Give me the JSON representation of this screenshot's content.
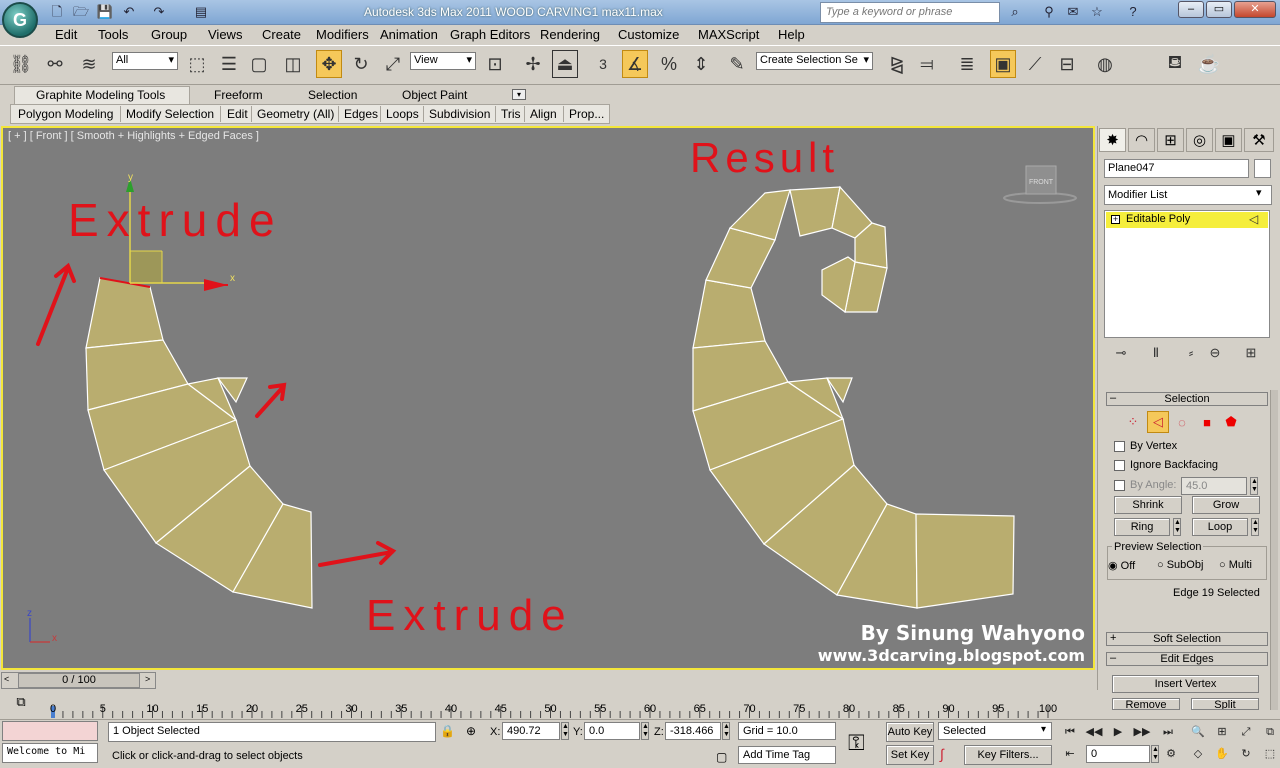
{
  "titlebar": {
    "title": "Autodesk 3ds Max  2011     WOOD CARVING1 max11.max",
    "search_placeholder": "Type a keyword or phrase",
    "logo_letter": "G",
    "minimize": "–",
    "maximize": "▭",
    "close": "✕"
  },
  "menu": [
    "Edit",
    "Tools",
    "Group",
    "Views",
    "Create",
    "Modifiers",
    "Animation",
    "Graph Editors",
    "Rendering",
    "Customize",
    "MAXScript",
    "Help"
  ],
  "toolbar": {
    "selection_filter": "All",
    "ref_coord": "View",
    "named_selection_placeholder": "Create Selection Se",
    "snap_3": "3",
    "percent": "%"
  },
  "ribbon": {
    "tabs": [
      "Graphite Modeling Tools",
      "Freeform",
      "Selection",
      "Object Paint"
    ],
    "panel_buttons": [
      "Polygon Modeling",
      "Modify Selection",
      "Edit",
      "Geometry (All)",
      "Edges",
      "Loops",
      "Subdivision",
      "Tris",
      "Align",
      "Prop..."
    ]
  },
  "viewport": {
    "label": "[ + ] [ Front ] [ Smooth + Highlights + Edged Faces ]",
    "viewcube_label": "FRONT",
    "annotations": {
      "extrude_top": "Extrude",
      "extrude_bottom": "Extrude",
      "result": "Result"
    },
    "watermark_line1": "By Sinung Wahyono",
    "watermark_line2": "www.3dcarving.blogspot.com",
    "gizmo_x": "x",
    "gizmo_y": "y",
    "axis_z": "z",
    "axis_x": "x",
    "colors": {
      "poly_fill": "#b9ad6f",
      "viewport_bg": "#7d7d7d",
      "annotation_red": "#e0121a",
      "active_border": "#f3e63a"
    }
  },
  "command_panel": {
    "object_name": "Plane047",
    "modifier_list": "Modifier List",
    "stack_item": "Editable Poly",
    "selection": {
      "title": "Selection",
      "by_vertex": "By Vertex",
      "ignore_backfacing": "Ignore Backfacing",
      "by_angle": "By Angle:",
      "angle_value": "45.0",
      "shrink": "Shrink",
      "grow": "Grow",
      "ring": "Ring",
      "loop": "Loop",
      "preview_title": "Preview Selection",
      "preview_off": "Off",
      "preview_subobj": "SubObj",
      "preview_multi": "Multi",
      "status": "Edge 19 Selected"
    },
    "soft_selection": "Soft Selection",
    "edit_edges": "Edit Edges",
    "insert_vertex": "Insert Vertex",
    "remove": "Remove",
    "split": "Split"
  },
  "timeline": {
    "frame_display": "0 / 100",
    "ticks": [
      "0",
      "5",
      "10",
      "15",
      "20",
      "25",
      "30",
      "35",
      "40",
      "45",
      "50",
      "55",
      "60",
      "65",
      "70",
      "75",
      "80",
      "85",
      "90",
      "95",
      "100"
    ]
  },
  "status": {
    "maxscript_text": "Welcome to Mi",
    "objects_selected": "1 Object Selected",
    "prompt": "Click or click-and-drag to select objects",
    "x_label": "X:",
    "x_value": "490.72",
    "y_label": "Y:",
    "y_value": "0.0",
    "z_label": "Z:",
    "z_value": "-318.466",
    "grid": "Grid = 10.0",
    "add_time_tag": "Add Time Tag",
    "auto_key": "Auto Key",
    "set_key": "Set Key",
    "key_mode": "Selected",
    "key_filters": "Key Filters...",
    "current_frame": "0"
  }
}
